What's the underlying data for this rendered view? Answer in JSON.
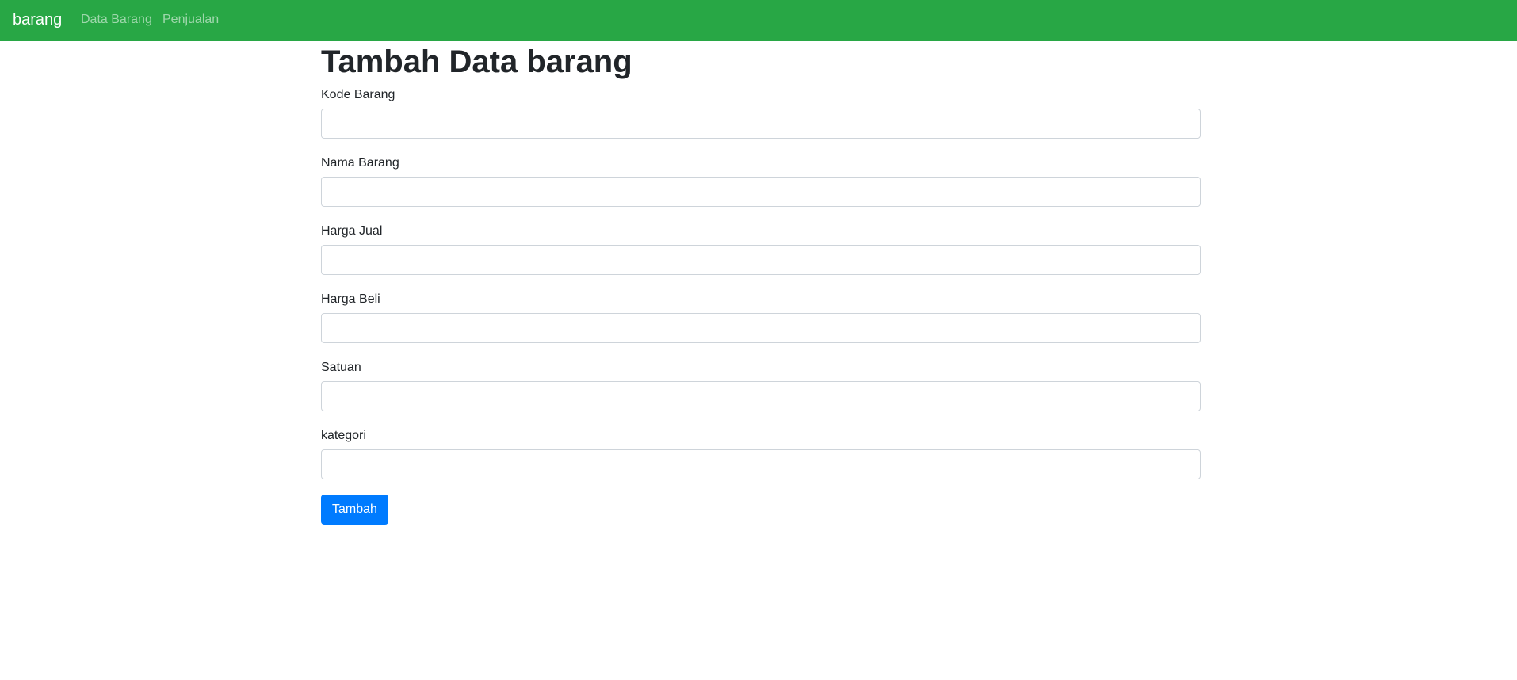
{
  "navbar": {
    "brand": "barang",
    "links": [
      {
        "label": "Data Barang"
      },
      {
        "label": "Penjualan"
      }
    ],
    "background_color": "#28a745"
  },
  "page": {
    "title": "Tambah Data barang"
  },
  "form": {
    "fields": [
      {
        "label": "Kode Barang",
        "value": ""
      },
      {
        "label": "Nama Barang",
        "value": ""
      },
      {
        "label": "Harga Jual",
        "value": ""
      },
      {
        "label": "Harga Beli",
        "value": ""
      },
      {
        "label": "Satuan",
        "value": ""
      },
      {
        "label": "kategori",
        "value": ""
      }
    ],
    "submit_label": "Tambah",
    "submit_color": "#007bff"
  }
}
